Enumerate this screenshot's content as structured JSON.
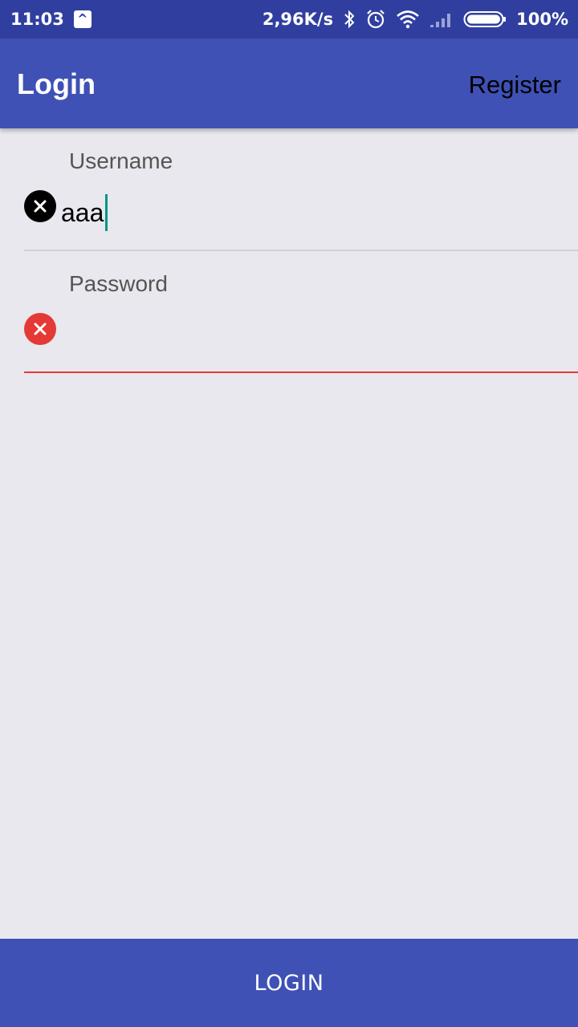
{
  "status_bar": {
    "time": "11:03",
    "network_speed": "2,96K/s",
    "battery": "100%",
    "icons": [
      "app-notification-icon",
      "bluetooth-icon",
      "alarm-icon",
      "wifi-icon",
      "signal-icon",
      "battery-icon"
    ]
  },
  "app_bar": {
    "title": "Login",
    "register_label": "Register"
  },
  "form": {
    "username": {
      "label": "Username",
      "value": "aaa"
    },
    "password": {
      "label": "Password",
      "value": ""
    }
  },
  "login_button": {
    "label": "LOGIN"
  },
  "colors": {
    "primary": "#3f51b5",
    "primary_dark": "#303f9f",
    "accent_cursor": "#009688",
    "error": "#e53935",
    "background": "#e8e8ee"
  }
}
